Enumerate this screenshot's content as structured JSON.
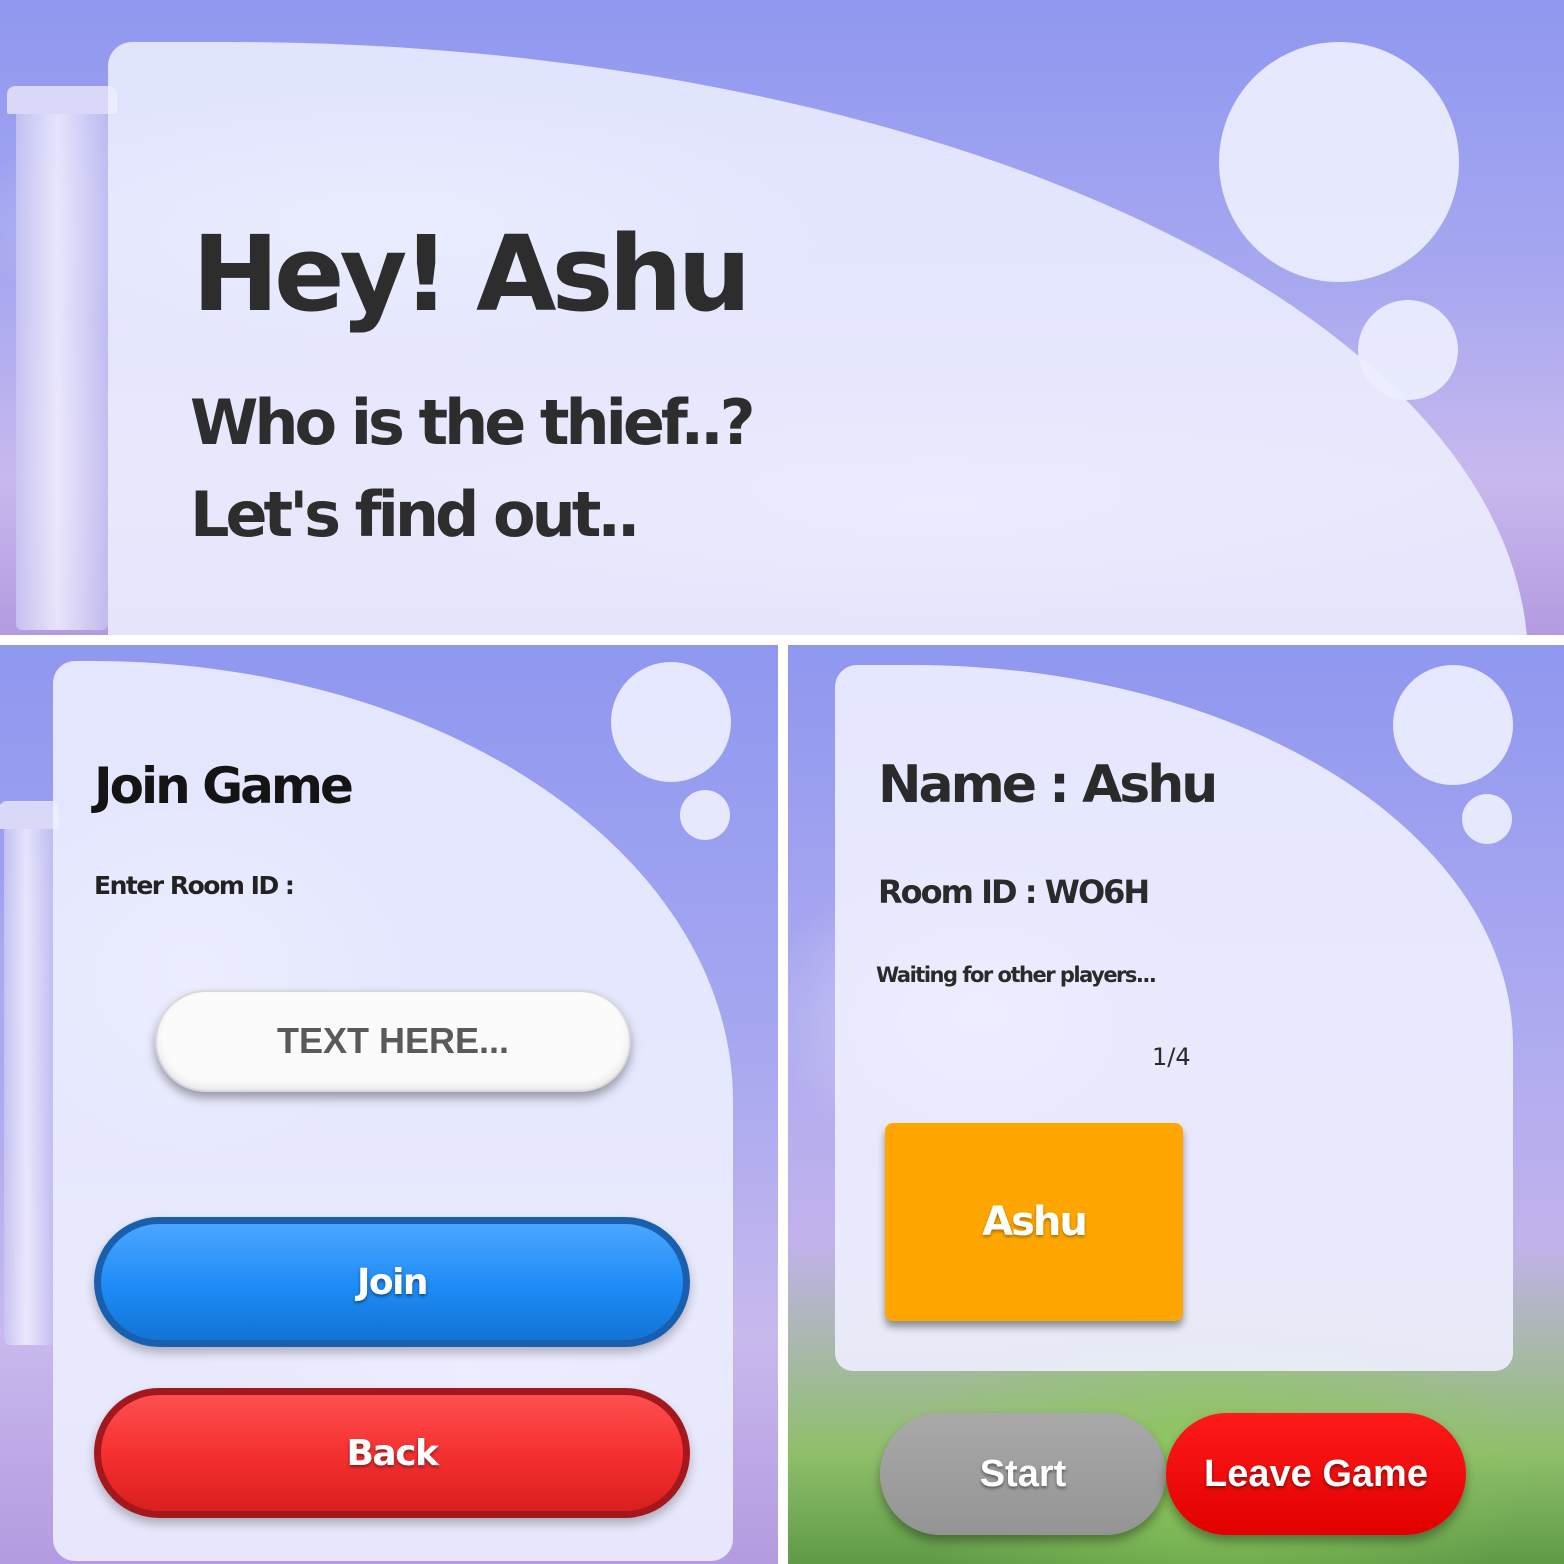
{
  "welcome": {
    "greeting": "Hey! Ashu",
    "tagline_line1": "Who is the thief..?",
    "tagline_line2": "Let's find out.."
  },
  "join": {
    "title": "Join Game",
    "room_label": "Enter Room ID :",
    "room_placeholder": "TEXT HERE...",
    "join_label": "Join",
    "back_label": "Back"
  },
  "lobby": {
    "name_line": "Name : Ashu",
    "room_id_line": "Room ID : WO6H",
    "waiting_text": "Waiting for other players...",
    "player_count": "1/4",
    "players": [
      "Ashu"
    ],
    "start_label": "Start",
    "leave_label": "Leave Game"
  },
  "colors": {
    "join_button": "#1d8bf5",
    "back_button": "#f42e2e",
    "player_card": "#ffa700",
    "start_button": "#a0a0a0",
    "leave_button": "#e10000"
  }
}
